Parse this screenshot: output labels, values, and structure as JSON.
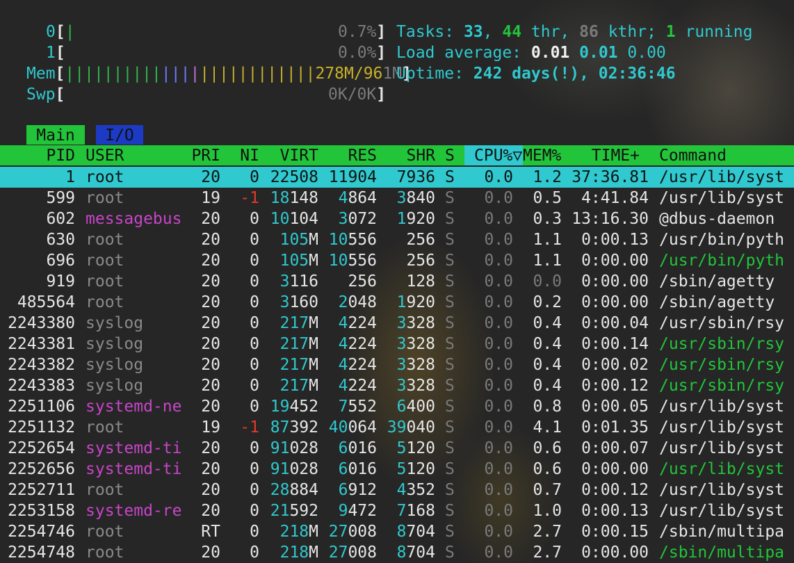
{
  "meters": {
    "cpu0": {
      "label": "0",
      "bar": "|",
      "value": "0.7%"
    },
    "cpu1": {
      "label": "1",
      "bar": "",
      "value": "0.0%"
    },
    "mem": {
      "label": "Mem",
      "bar_green": "||||||||||",
      "bar_blue": "|||",
      "bar_mag": "|",
      "bar_yel": "||||||||||||278M/96",
      "value_tail": "1M"
    },
    "swp": {
      "label": "Swp",
      "value": "0K/0K"
    }
  },
  "summary": {
    "tasks_label": "Tasks: ",
    "tasks": "33",
    "threads": "44",
    "thr_label": " thr, ",
    "kthr": "86",
    "kthr_label": " kthr; ",
    "running": "1",
    "running_label": " running",
    "load_label": "Load average: ",
    "load1": "0.01",
    "load5": "0.01",
    "load15": "0.00",
    "uptime_label": "Uptime: ",
    "uptime": "242 days(!), 02:36:46"
  },
  "tabs": {
    "main": "Main",
    "io": "I/O"
  },
  "columns": {
    "pid": "PID",
    "user": "USER",
    "pri": "PRI",
    "ni": "NI",
    "virt": "VIRT",
    "res": "RES",
    "shr": "SHR",
    "s": "S",
    "cpu": "CPU%▽",
    "mem": "MEM%",
    "time": "TIME+",
    "command": "Command"
  },
  "processes": [
    {
      "pid": "1",
      "user": "root",
      "pri": "20",
      "ni": "0",
      "virt": "22508",
      "res": "11904",
      "shr": "7936",
      "s": "S",
      "cpu": "0.0",
      "mem": "1.2",
      "time": "37:36.81",
      "command": "/usr/lib/syst"
    },
    {
      "pid": "599",
      "user": "root",
      "pri": "19",
      "ni": "-1",
      "virt": "18148",
      "res": "4864",
      "shr": "3840",
      "s": "S",
      "cpu": "0.0",
      "mem": "0.5",
      "time": "4:41.84",
      "command": "/usr/lib/syst"
    },
    {
      "pid": "602",
      "user": "messagebus",
      "pri": "20",
      "ni": "0",
      "virt": "10104",
      "res": "3072",
      "shr": "1920",
      "s": "S",
      "cpu": "0.0",
      "mem": "0.3",
      "time": "13:16.30",
      "command": "@dbus-daemon"
    },
    {
      "pid": "630",
      "user": "root",
      "pri": "20",
      "ni": "0",
      "virt": "105M",
      "res": "10556",
      "shr": "256",
      "s": "S",
      "cpu": "0.0",
      "mem": "1.1",
      "time": "0:00.13",
      "command": "/usr/bin/pyth"
    },
    {
      "pid": "696",
      "user": "root",
      "pri": "20",
      "ni": "0",
      "virt": "105M",
      "res": "10556",
      "shr": "256",
      "s": "S",
      "cpu": "0.0",
      "mem": "1.1",
      "time": "0:00.00",
      "command": "/usr/bin/pyth"
    },
    {
      "pid": "919",
      "user": "root",
      "pri": "20",
      "ni": "0",
      "virt": "3116",
      "res": "256",
      "shr": "128",
      "s": "S",
      "cpu": "0.0",
      "mem": "0.0",
      "time": "0:00.00",
      "command": "/sbin/agetty"
    },
    {
      "pid": "485564",
      "user": "root",
      "pri": "20",
      "ni": "0",
      "virt": "3160",
      "res": "2048",
      "shr": "1920",
      "s": "S",
      "cpu": "0.0",
      "mem": "0.2",
      "time": "0:00.00",
      "command": "/sbin/agetty"
    },
    {
      "pid": "2243380",
      "user": "syslog",
      "pri": "20",
      "ni": "0",
      "virt": "217M",
      "res": "4224",
      "shr": "3328",
      "s": "S",
      "cpu": "0.0",
      "mem": "0.4",
      "time": "0:00.04",
      "command": "/usr/sbin/rsy"
    },
    {
      "pid": "2243381",
      "user": "syslog",
      "pri": "20",
      "ni": "0",
      "virt": "217M",
      "res": "4224",
      "shr": "3328",
      "s": "S",
      "cpu": "0.0",
      "mem": "0.4",
      "time": "0:00.14",
      "command": "/usr/sbin/rsy"
    },
    {
      "pid": "2243382",
      "user": "syslog",
      "pri": "20",
      "ni": "0",
      "virt": "217M",
      "res": "4224",
      "shr": "3328",
      "s": "S",
      "cpu": "0.0",
      "mem": "0.4",
      "time": "0:00.02",
      "command": "/usr/sbin/rsy"
    },
    {
      "pid": "2243383",
      "user": "syslog",
      "pri": "20",
      "ni": "0",
      "virt": "217M",
      "res": "4224",
      "shr": "3328",
      "s": "S",
      "cpu": "0.0",
      "mem": "0.4",
      "time": "0:00.12",
      "command": "/usr/sbin/rsy"
    },
    {
      "pid": "2251106",
      "user": "systemd-ne",
      "pri": "20",
      "ni": "0",
      "virt": "19452",
      "res": "7552",
      "shr": "6400",
      "s": "S",
      "cpu": "0.0",
      "mem": "0.8",
      "time": "0:00.05",
      "command": "/usr/lib/syst"
    },
    {
      "pid": "2251132",
      "user": "root",
      "pri": "19",
      "ni": "-1",
      "virt": "87392",
      "res": "40064",
      "shr": "39040",
      "s": "S",
      "cpu": "0.0",
      "mem": "4.1",
      "time": "0:01.35",
      "command": "/usr/lib/syst"
    },
    {
      "pid": "2252654",
      "user": "systemd-ti",
      "pri": "20",
      "ni": "0",
      "virt": "91028",
      "res": "6016",
      "shr": "5120",
      "s": "S",
      "cpu": "0.0",
      "mem": "0.6",
      "time": "0:00.07",
      "command": "/usr/lib/syst"
    },
    {
      "pid": "2252656",
      "user": "systemd-ti",
      "pri": "20",
      "ni": "0",
      "virt": "91028",
      "res": "6016",
      "shr": "5120",
      "s": "S",
      "cpu": "0.0",
      "mem": "0.6",
      "time": "0:00.00",
      "command": "/usr/lib/syst"
    },
    {
      "pid": "2252711",
      "user": "root",
      "pri": "20",
      "ni": "0",
      "virt": "28884",
      "res": "6912",
      "shr": "4352",
      "s": "S",
      "cpu": "0.0",
      "mem": "0.7",
      "time": "0:00.12",
      "command": "/usr/lib/syst"
    },
    {
      "pid": "2253158",
      "user": "systemd-re",
      "pri": "20",
      "ni": "0",
      "virt": "21592",
      "res": "9472",
      "shr": "7168",
      "s": "S",
      "cpu": "0.0",
      "mem": "1.0",
      "time": "0:00.13",
      "command": "/usr/lib/syst"
    },
    {
      "pid": "2254746",
      "user": "root",
      "pri": "RT",
      "ni": "0",
      "virt": "218M",
      "res": "27008",
      "shr": "8704",
      "s": "S",
      "cpu": "0.0",
      "mem": "2.7",
      "time": "0:00.15",
      "command": "/sbin/multipa"
    },
    {
      "pid": "2254748",
      "user": "root",
      "pri": "20",
      "ni": "0",
      "virt": "218M",
      "res": "27008",
      "shr": "8704",
      "s": "S",
      "cpu": "0.0",
      "mem": "2.7",
      "time": "0:00.00",
      "command": "/sbin/multipa"
    }
  ],
  "colors": {
    "accent_green": "#22c53a",
    "accent_cyan": "#2fc9cf",
    "io_blue": "#1c3ac4",
    "user_magenta": "#c845c8",
    "nice_red": "#e03a2a"
  }
}
